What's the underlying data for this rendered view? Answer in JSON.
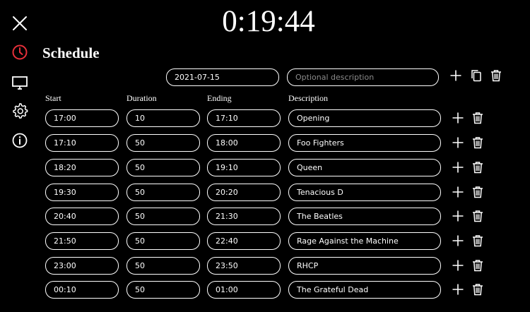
{
  "clock": {
    "time": "0:19:44"
  },
  "page": {
    "title": "Schedule"
  },
  "sidebar": {
    "icons": [
      "close-icon",
      "clock-icon",
      "monitor-icon",
      "gear-icon",
      "info-icon"
    ],
    "active_color": "#e8303a"
  },
  "toolbar": {
    "date_value": "2021-07-15",
    "description_placeholder": "Optional description"
  },
  "columns": {
    "start": "Start",
    "duration": "Duration",
    "ending": "Ending",
    "description": "Description"
  },
  "rows": [
    {
      "start": "17:00",
      "duration": "10",
      "ending": "17:10",
      "description": "Opening"
    },
    {
      "start": "17:10",
      "duration": "50",
      "ending": "18:00",
      "description": "Foo Fighters"
    },
    {
      "start": "18:20",
      "duration": "50",
      "ending": "19:10",
      "description": "Queen"
    },
    {
      "start": "19:30",
      "duration": "50",
      "ending": "20:20",
      "description": "Tenacious D"
    },
    {
      "start": "20:40",
      "duration": "50",
      "ending": "21:30",
      "description": "The Beatles"
    },
    {
      "start": "21:50",
      "duration": "50",
      "ending": "22:40",
      "description": "Rage Against the Machine"
    },
    {
      "start": "23:00",
      "duration": "50",
      "ending": "23:50",
      "description": "RHCP"
    },
    {
      "start": "00:10",
      "duration": "50",
      "ending": "01:00",
      "description": "The Grateful Dead"
    }
  ]
}
